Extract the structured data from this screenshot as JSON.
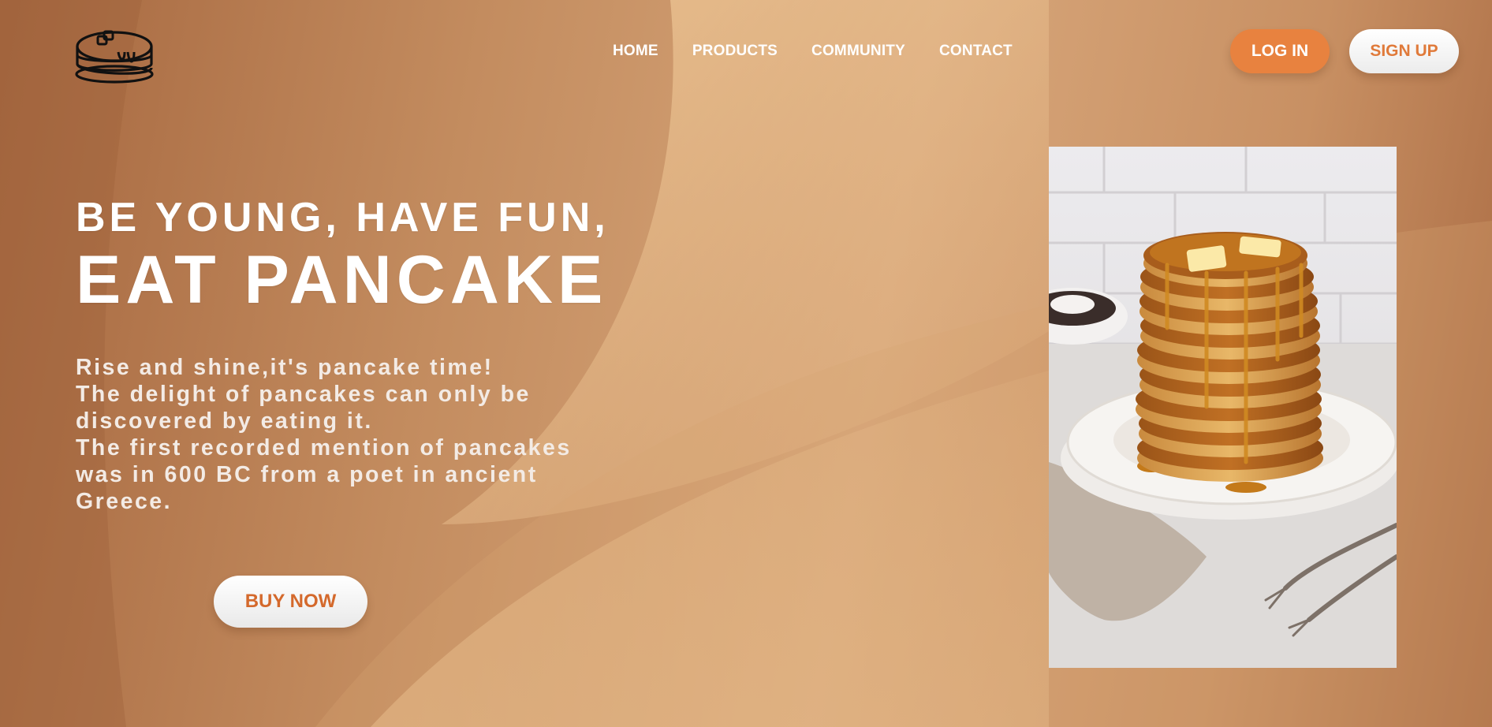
{
  "logo": {
    "icon": "pancake-stack-logo-icon"
  },
  "nav": {
    "items": [
      {
        "label": "HOME"
      },
      {
        "label": "PRODUCTS"
      },
      {
        "label": "COMMUNITY"
      },
      {
        "label": "CONTACT"
      }
    ]
  },
  "auth": {
    "login_label": "LOG IN",
    "signup_label": "SIGN UP"
  },
  "hero": {
    "subtitle": "BE YOUNG, HAVE FUN,",
    "title": "EAT PANCAKE",
    "lines": [
      "Rise and shine,it's pancake time!",
      "The delight of pancakes can only be",
      "discovered by eating it.",
      "The first recorded mention of pancakes",
      "was in 600 BC from a poet in ancient",
      "Greece."
    ],
    "cta_label": "BUY NOW"
  },
  "photo": {
    "subject": "stack-of-pancakes-with-syrup-and-butter"
  },
  "colors": {
    "accent_orange": "#e8823f",
    "cta_text": "#d4692c",
    "background_light": "#d7a67a",
    "background_dark": "#a6673f"
  }
}
